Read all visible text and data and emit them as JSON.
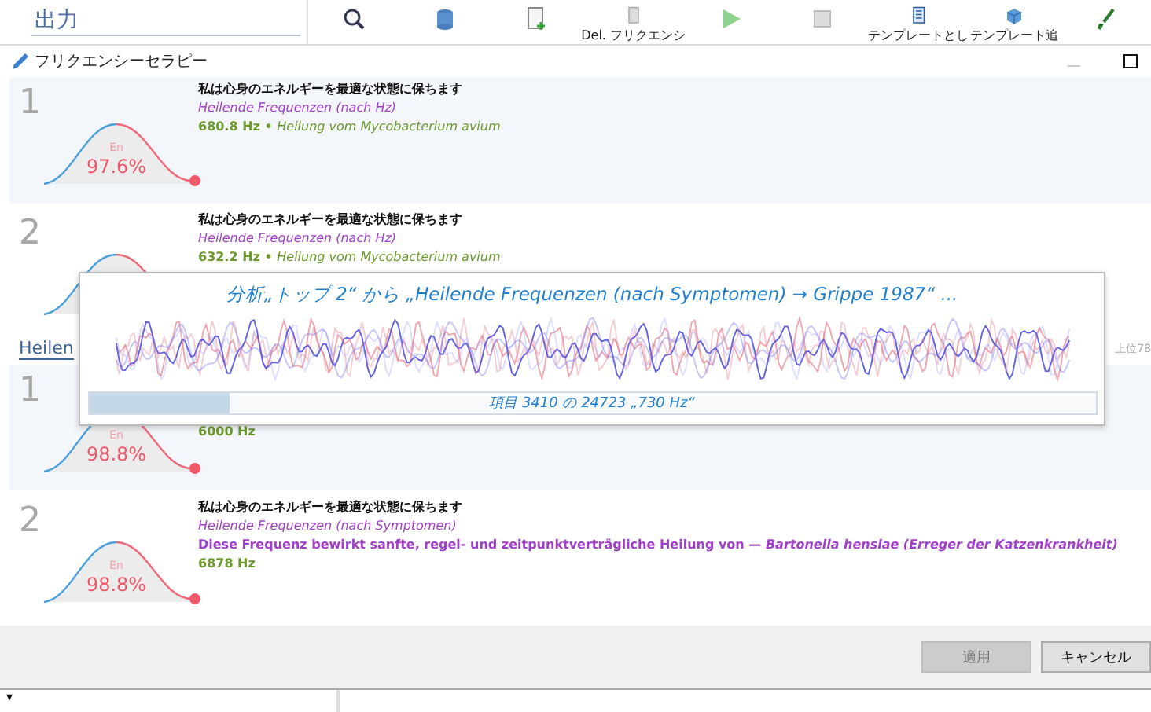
{
  "toolbar": {
    "heading": "出力",
    "buttons": [
      {
        "kind": "search"
      },
      {
        "kind": "database"
      },
      {
        "kind": "add-doc"
      },
      {
        "kind": "delete",
        "label": "Del. フリクエンシ"
      },
      {
        "kind": "play"
      },
      {
        "kind": "stop"
      },
      {
        "kind": "template",
        "label": "テンプレートとし"
      },
      {
        "kind": "template-add",
        "label": "テンプレート追"
      },
      {
        "kind": "brush"
      }
    ]
  },
  "dialog": {
    "title": "フリクエンシーセラピー"
  },
  "groups": [
    {
      "items": [
        {
          "rank": "1",
          "title": "私は心身のエネルギーを最適な状態に保ちます",
          "category": "Heilende Frequenzen (nach Hz)",
          "frequency": "680.8 Hz",
          "separator": "•",
          "target": "Heilung vom Mycobacterium avium",
          "chart": {
            "label": "En",
            "percent": "97.6%"
          }
        },
        {
          "rank": "2",
          "title": "私は心身のエネルギーを最適な状態に保ちます",
          "category": "Heilende Frequenzen (nach Hz)",
          "frequency": "632.2 Hz",
          "separator": "•",
          "target": "Heilung vom Mycobacterium avium"
        }
      ]
    },
    {
      "heading": "Heilen",
      "count": "上位78",
      "items": [
        {
          "rank": "1",
          "frequency": "6000 Hz",
          "chart": {
            "label": "En",
            "percent": "98.8%"
          }
        },
        {
          "rank": "2",
          "title": "私は心身のエネルギーを最適な状態に保ちます",
          "category": "Heilende Frequenzen (nach Symptomen)",
          "description": "Diese Frequenz bewirkt sanfte, regel- und zeitpunktverträgliche Heilung von — *Bartonella henslae (Erreger der Katzenkrankheit)*",
          "frequency": "6878 Hz",
          "chart": {
            "label": "En",
            "percent": "98.8%"
          }
        }
      ]
    }
  ],
  "progress": {
    "title": "分析„トップ 2“ から „Heilende Frequenzen (nach Symptomen) → Grippe 1987“ ...",
    "level": 0.14,
    "text": "項目 3410 の 24723 „730 Hz“"
  },
  "footer": {
    "buttons": [
      {
        "label": "適用",
        "disabled": true
      },
      {
        "label": "キャンセル",
        "disabled": false
      }
    ]
  },
  "status": {
    "dropdown": "▾"
  }
}
